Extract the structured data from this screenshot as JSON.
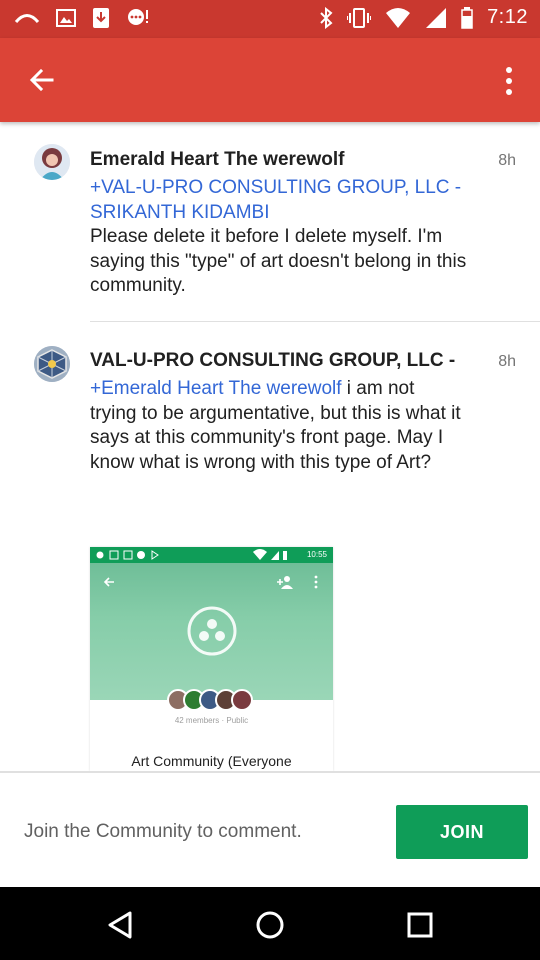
{
  "status_bar": {
    "time": "7:12"
  },
  "app_bar": {
    "back_icon": "arrow-left-icon",
    "menu_icon": "more-vert-icon"
  },
  "posts": [
    {
      "author": "Emerald Heart The werewolf",
      "timestamp": "8h",
      "mention": "+VAL-U-PRO CONSULTING GROUP, LLC - SRIKANTH KIDAMBI",
      "text": "Please delete it before I delete myself. I'm saying this \"type\" of art doesn't belong in this community."
    },
    {
      "author": "VAL-U-PRO CONSULTING GROUP, LLC -",
      "timestamp": "8h",
      "mention": "+Emerald Heart The werewolf",
      "text": " i am not trying to be argumentative, but this is what it says at this community's front page. May I know what is wrong with this type of Art?"
    }
  ],
  "embedded_screenshot": {
    "time": "10:55",
    "members": "42 members · Public",
    "title": "Art Community (Everyone"
  },
  "footer": {
    "prompt": "Join the Community to comment.",
    "join_label": "JOIN"
  },
  "colors": {
    "app_bar": "#dc4437",
    "status_bar": "#c9382f",
    "link": "#3367d6",
    "join": "#0f9d58"
  }
}
